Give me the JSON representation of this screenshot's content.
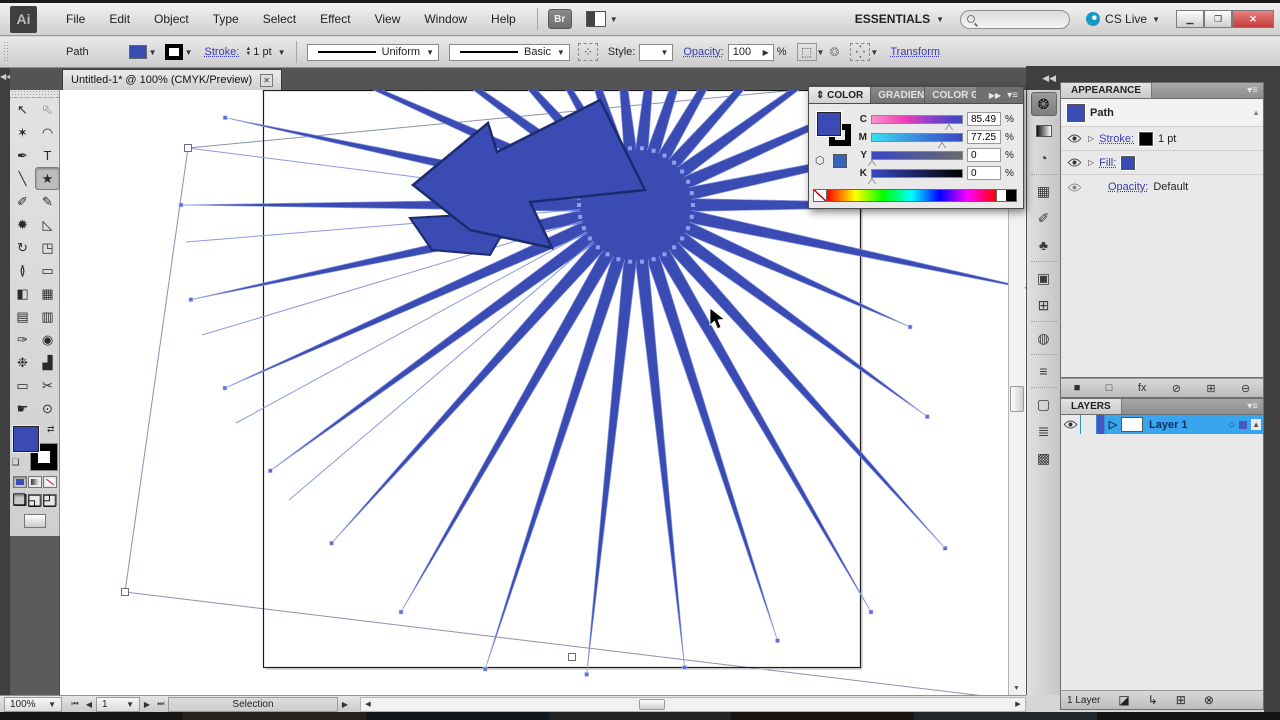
{
  "chrome": {
    "app_icon": "Ai",
    "menus": [
      "File",
      "Edit",
      "Object",
      "Type",
      "Select",
      "Effect",
      "View",
      "Window",
      "Help"
    ],
    "bridge_label": "Br",
    "workspace": "ESSENTIALS",
    "cs_live": "CS Live",
    "window_controls": {
      "minimize": "▁",
      "restore": "❐",
      "close": "✕"
    }
  },
  "control_bar": {
    "selection_type": "Path",
    "stroke_label": "Stroke:",
    "stroke_value": "1 pt",
    "width_profile": "Uniform",
    "brush": "Basic",
    "style_label": "Style:",
    "opacity_label": "Opacity:",
    "opacity_value": "100",
    "percent": "%",
    "transform": "Transform"
  },
  "doc_tab": {
    "title": "Untitled-1* @ 100% (CMYK/Preview)"
  },
  "toolbar": {
    "tools": [
      {
        "name": "selection-tool",
        "glyph": "↖"
      },
      {
        "name": "direct-selection-tool",
        "glyph": "↖"
      },
      {
        "name": "magic-wand-tool",
        "glyph": "✶"
      },
      {
        "name": "lasso-tool",
        "glyph": "◠"
      },
      {
        "name": "pen-tool",
        "glyph": "✒"
      },
      {
        "name": "type-tool",
        "glyph": "T"
      },
      {
        "name": "line-segment-tool",
        "glyph": "╲"
      },
      {
        "name": "star-tool",
        "glyph": "★",
        "selected": true
      },
      {
        "name": "paintbrush-tool",
        "glyph": "✐"
      },
      {
        "name": "pencil-tool",
        "glyph": "✎"
      },
      {
        "name": "blob-brush-tool",
        "glyph": "✹"
      },
      {
        "name": "eraser-tool",
        "glyph": "◺"
      },
      {
        "name": "rotate-tool",
        "glyph": "↻"
      },
      {
        "name": "scale-tool",
        "glyph": "◳"
      },
      {
        "name": "width-tool",
        "glyph": "≬"
      },
      {
        "name": "free-transform-tool",
        "glyph": "▭"
      },
      {
        "name": "shape-builder-tool",
        "glyph": "◧"
      },
      {
        "name": "perspective-grid-tool",
        "glyph": "▦"
      },
      {
        "name": "mesh-tool",
        "glyph": "▤"
      },
      {
        "name": "gradient-tool",
        "glyph": "▥"
      },
      {
        "name": "eyedropper-tool",
        "glyph": "✑"
      },
      {
        "name": "blend-tool",
        "glyph": "◉"
      },
      {
        "name": "symbol-sprayer-tool",
        "glyph": "❉"
      },
      {
        "name": "column-graph-tool",
        "glyph": "▟"
      },
      {
        "name": "artboard-tool",
        "glyph": "▭"
      },
      {
        "name": "slice-tool",
        "glyph": "✂"
      },
      {
        "name": "hand-tool",
        "glyph": "☛"
      },
      {
        "name": "zoom-tool",
        "glyph": "⊙"
      }
    ]
  },
  "dock_icons": [
    {
      "name": "color-panel-icon",
      "glyph": "❂",
      "active": true
    },
    {
      "name": "gradient-panel-icon",
      "glyph": "",
      "gradient": true
    },
    {
      "name": "color-guide-panel-icon",
      "glyph": "◔"
    },
    {
      "name": "swatches-panel-icon",
      "glyph": "▦",
      "divider": true
    },
    {
      "name": "brushes-panel-icon",
      "glyph": "✐"
    },
    {
      "name": "symbols-panel-icon",
      "glyph": "♣"
    },
    {
      "name": "graphic-styles-panel-icon",
      "glyph": "▣",
      "divider": true
    },
    {
      "name": "artboards-panel-icon",
      "glyph": "⊞"
    },
    {
      "name": "transparency-panel-icon",
      "glyph": "◍",
      "divider": true
    },
    {
      "name": "stroke-panel-icon",
      "glyph": "≡",
      "divider": true
    },
    {
      "name": "transform-panel-icon",
      "glyph": "▢",
      "divider": true
    },
    {
      "name": "align-panel-icon",
      "glyph": "≣"
    },
    {
      "name": "pathfinder-panel-icon",
      "glyph": "▩"
    }
  ],
  "color_panel": {
    "collapse_icon": "⇕",
    "tab_active": "COLOR",
    "tab_gradient": "GRADIEN",
    "tab_guide": "COLOR G",
    "expand_icon": "▶▶",
    "menu_icon": "▾≡",
    "sliders": [
      {
        "label": "C",
        "value": "85.49",
        "pct": 85.49
      },
      {
        "label": "M",
        "value": "77.25",
        "pct": 77.25
      },
      {
        "label": "Y",
        "value": "0",
        "pct": 0
      },
      {
        "label": "K",
        "value": "0",
        "pct": 0
      }
    ],
    "unit": "%"
  },
  "appearance": {
    "title": "APPEARANCE",
    "object_label": "Path",
    "stroke_label": "Stroke:",
    "stroke_value": "1 pt",
    "fill_label": "Fill:",
    "opacity_label": "Opacity:",
    "opacity_value": "Default",
    "footer_icons": [
      {
        "name": "add-new-stroke-button",
        "glyph": "■"
      },
      {
        "name": "add-new-fill-button",
        "glyph": "□"
      },
      {
        "name": "add-new-effect-button",
        "glyph": "fx"
      },
      {
        "name": "clear-appearance-button",
        "glyph": "⊘"
      },
      {
        "name": "duplicate-item-button",
        "glyph": "⊞"
      },
      {
        "name": "delete-item-button",
        "glyph": "⊖"
      }
    ]
  },
  "layers": {
    "title": "LAYERS",
    "layer_name": "Layer 1",
    "count_label": "1 Layer",
    "footer_icons": [
      {
        "name": "make-clipping-mask-button",
        "glyph": "◪"
      },
      {
        "name": "create-sublayer-button",
        "glyph": "↳"
      },
      {
        "name": "create-new-layer-button",
        "glyph": "⊞"
      },
      {
        "name": "delete-layer-button",
        "glyph": "⊗"
      }
    ]
  },
  "status_bar": {
    "zoom": "100%",
    "artboard_value": "1",
    "tool_status": "Selection"
  },
  "artwork": {
    "fill": "#3a4cb4",
    "outline": "#1c2a6e",
    "selection_line": "#8b9ae0",
    "anchor": "#5a6fd6",
    "artboard_border": "#1a1a1a"
  }
}
